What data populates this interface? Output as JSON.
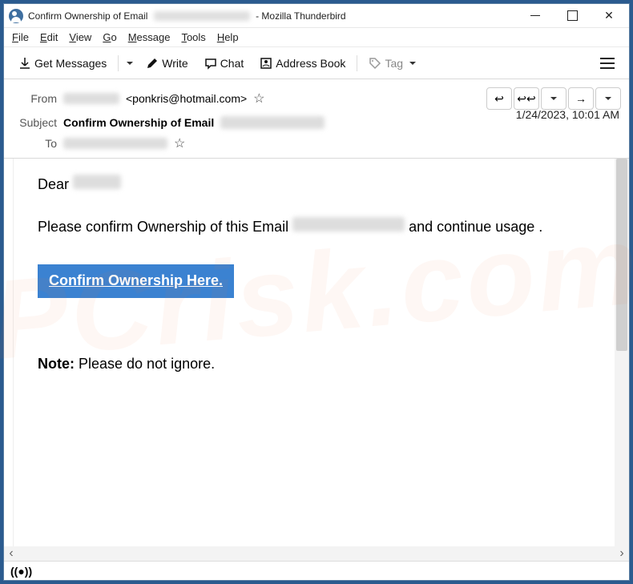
{
  "watermark": "PCrisk.com",
  "window": {
    "title_prefix": "Confirm Ownership of Email",
    "title_suffix": " - Mozilla Thunderbird"
  },
  "menubar": [
    "File",
    "Edit",
    "View",
    "Go",
    "Message",
    "Tools",
    "Help"
  ],
  "toolbar": {
    "get_messages": "Get Messages",
    "write": "Write",
    "chat": "Chat",
    "address_book": "Address Book",
    "tag": "Tag"
  },
  "headers": {
    "from_label": "From",
    "from_email": "<ponkris@hotmail.com>",
    "subject_label": "Subject",
    "subject_value": "Confirm Ownership of Email",
    "to_label": "To",
    "date": "1/24/2023, 10:01 AM"
  },
  "body": {
    "greeting": "Dear ",
    "p1a": "Please confirm Ownership of   this Email ",
    "p1b": " and continue usage .",
    "cta": "Confirm Ownership Here.",
    "note_label": "Note:",
    "note_text": "  Please do not ignore."
  },
  "status_icon": "((●))"
}
